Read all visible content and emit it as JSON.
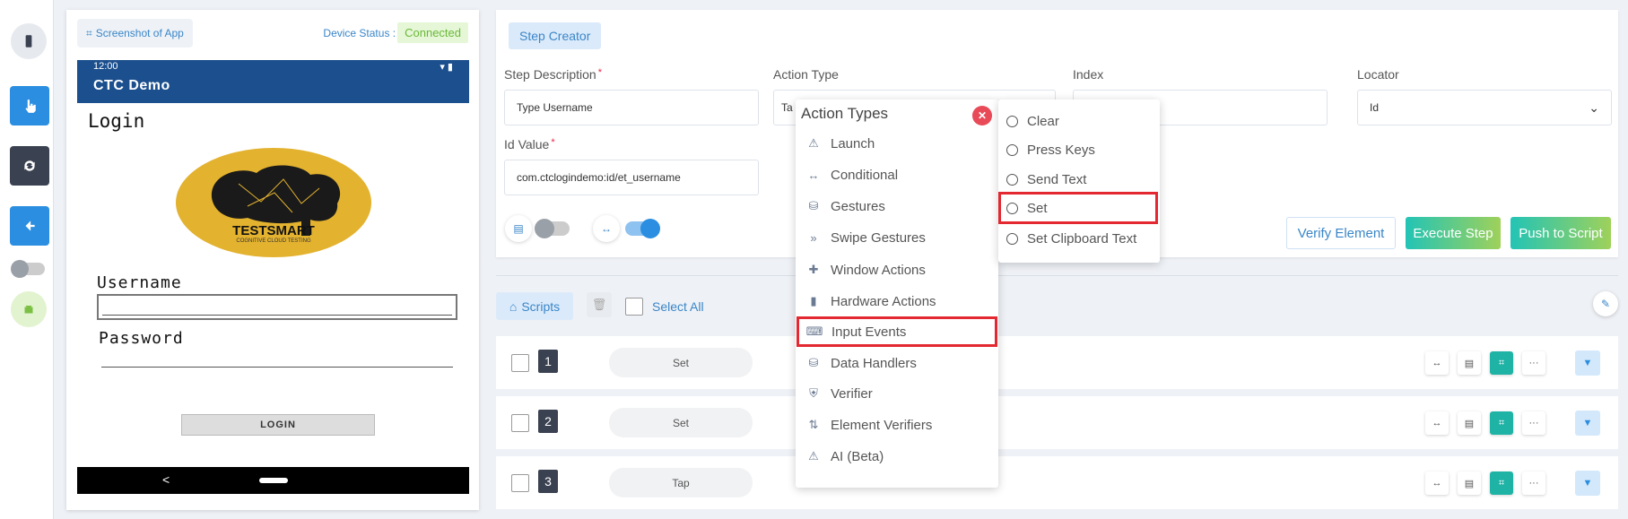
{
  "device": {
    "screenshot_btn": "Screenshot of App",
    "status_label": "Device Status :",
    "status_value": "Connected"
  },
  "phone": {
    "time": "12:00",
    "app_title": "CTC Demo",
    "screen_title": "Login",
    "logo_text": "TESTSMART",
    "logo_sub": "COGNITIVE CLOUD TESTING",
    "username_label": "Username",
    "password_label": "Password",
    "login_button": "LOGIN",
    "nav_back": "<"
  },
  "creator": {
    "tab": "Step Creator",
    "step_desc_label": "Step Description",
    "step_desc_value": "Type Username",
    "action_type_label": "Action Type",
    "action_type_value": "Ta",
    "index_label": "Index",
    "locator_label": "Locator",
    "locator_value": "Id",
    "id_value_label": "Id Value",
    "id_value_value": "com.ctclogindemo:id/et_username",
    "verify_btn": "Verify Element",
    "execute_btn": "Execute Step",
    "push_btn": "Push to Script"
  },
  "scripts": {
    "tab": "Scripts",
    "select_all": "Select All",
    "rows": [
      {
        "num": "1",
        "action": "Set"
      },
      {
        "num": "2",
        "action": "Set"
      },
      {
        "num": "3",
        "action": "Tap"
      }
    ]
  },
  "action_types": {
    "header": "Action Types",
    "items": [
      {
        "label": "Launch",
        "icon": "warning-icon"
      },
      {
        "label": "Conditional",
        "icon": "arrows-horizontal-icon"
      },
      {
        "label": "Gestures",
        "icon": "database-icon"
      },
      {
        "label": "Swipe Gestures",
        "icon": "double-chevron-right-icon"
      },
      {
        "label": "Window Actions",
        "icon": "puzzle-icon"
      },
      {
        "label": "Hardware Actions",
        "icon": "file-icon"
      },
      {
        "label": "Input Events",
        "icon": "keyboard-icon"
      },
      {
        "label": "Data Handlers",
        "icon": "database-icon"
      },
      {
        "label": "Verifier",
        "icon": "shield-check-icon"
      },
      {
        "label": "Element Verifiers",
        "icon": "git-compare-icon"
      },
      {
        "label": "AI (Beta)",
        "icon": "warning-icon"
      }
    ]
  },
  "input_events": {
    "options": [
      "Clear",
      "Press Keys",
      "Send Text",
      "Set",
      "Set Clipboard Text"
    ]
  },
  "colors": {
    "primary": "#2b8ee0",
    "dark": "#3a4150",
    "teal": "#1fb3a6",
    "highlight": "#e32831"
  }
}
